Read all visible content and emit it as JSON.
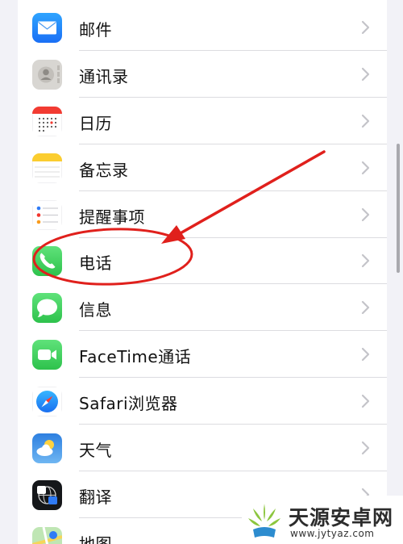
{
  "settings": {
    "items": [
      {
        "label": "邮件",
        "icon": "mail-icon"
      },
      {
        "label": "通讯录",
        "icon": "contacts-icon"
      },
      {
        "label": "日历",
        "icon": "calendar-icon"
      },
      {
        "label": "备忘录",
        "icon": "notes-icon"
      },
      {
        "label": "提醒事项",
        "icon": "reminders-icon"
      },
      {
        "label": "电话",
        "icon": "phone-icon"
      },
      {
        "label": "信息",
        "icon": "messages-icon"
      },
      {
        "label": "FaceTime通话",
        "icon": "facetime-icon"
      },
      {
        "label": "Safari浏览器",
        "icon": "safari-icon"
      },
      {
        "label": "天气",
        "icon": "weather-icon"
      },
      {
        "label": "翻译",
        "icon": "translate-icon"
      },
      {
        "label": "地图",
        "icon": "maps-icon"
      }
    ]
  },
  "annotation": {
    "color": "#e0201c",
    "highlighted_item": "电话"
  },
  "watermark": {
    "title": "天源安卓网",
    "url": "www.jytyaz.com"
  }
}
